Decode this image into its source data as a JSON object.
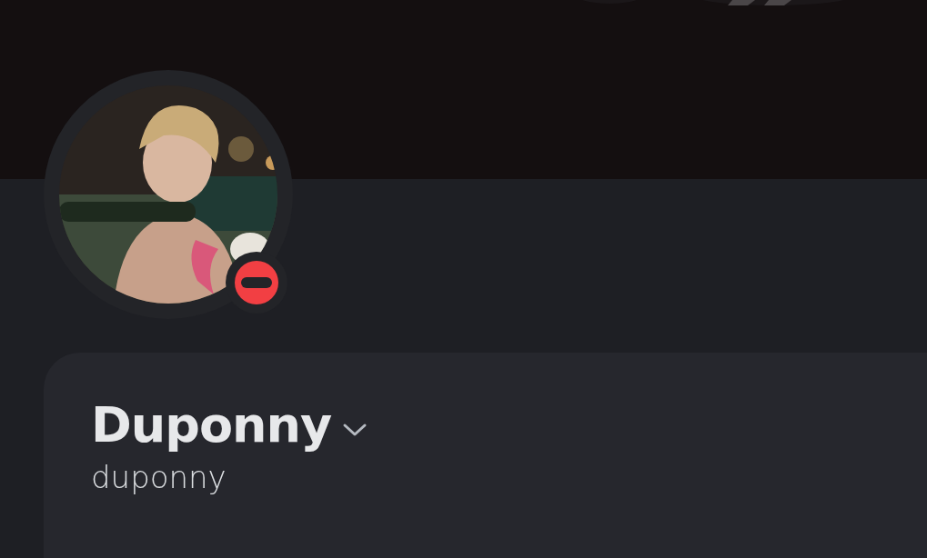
{
  "profile": {
    "do_not_disturb": true,
    "display_name": "Duponny",
    "username": "duponny"
  }
}
